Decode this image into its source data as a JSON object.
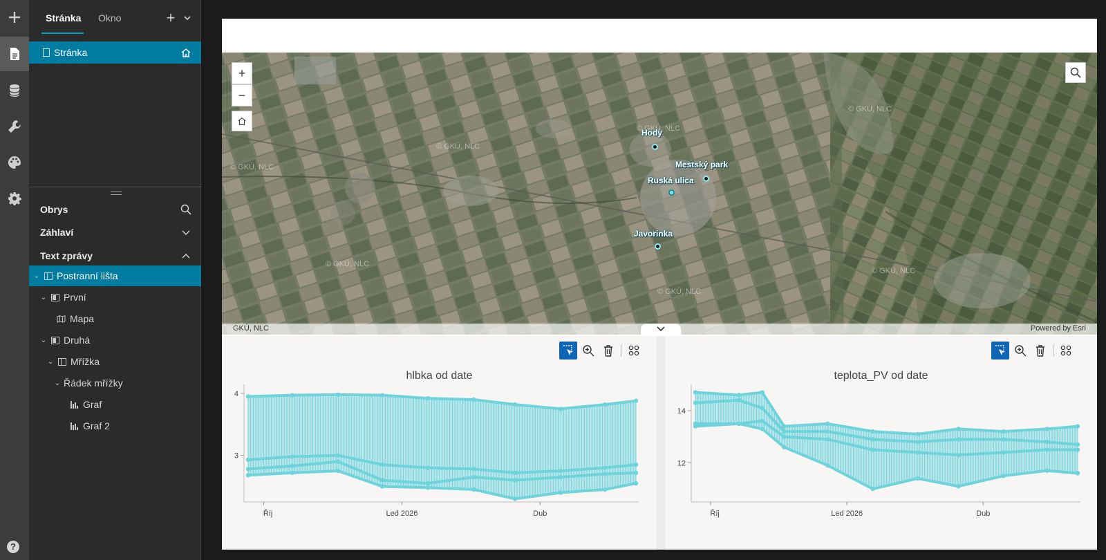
{
  "panel": {
    "tabs": [
      {
        "label": "Stránka",
        "active": true
      },
      {
        "label": "Okno",
        "active": false
      }
    ],
    "pages": [
      {
        "label": "Stránka"
      }
    ],
    "outline": {
      "title": "Obrys"
    },
    "sections": [
      {
        "label": "Záhlaví",
        "expanded": false
      },
      {
        "label": "Text zprávy",
        "expanded": true
      }
    ],
    "tree": [
      {
        "label": "Postranní lišta",
        "icon": "sidebar-layout-icon",
        "selected": true
      },
      {
        "label": "První",
        "icon": "section-icon"
      },
      {
        "label": "Mapa",
        "icon": "map-icon"
      },
      {
        "label": "Druhá",
        "icon": "section-icon"
      },
      {
        "label": "Mřížka",
        "icon": "grid-icon"
      },
      {
        "label": "Řádek mřížky",
        "icon": ""
      },
      {
        "label": "Graf",
        "icon": "bar-chart-icon"
      },
      {
        "label": "Graf 2",
        "icon": "bar-chart-icon"
      }
    ]
  },
  "map": {
    "attribution_left": "GKÚ, NLC",
    "attribution_right": "Powered by Esri",
    "watermarks": [
      "© GKÚ, NLC",
      "© GKÚ, NLC",
      "© GKÚ, NLC",
      "© GKÚ, NLC",
      "© GKÚ, NLC",
      "© GKÚ, NLC",
      "© GKÚ, NLC"
    ],
    "points": [
      {
        "name": "Hody"
      },
      {
        "name": "Mestský park"
      },
      {
        "name": "Ruská ulica"
      },
      {
        "name": "Javorinka"
      }
    ],
    "zoom_in": "+",
    "zoom_out": "−"
  },
  "chart_data": [
    {
      "type": "area",
      "title": "hlbka od date",
      "x_ticks": [
        "Říj",
        "Led 2026",
        "Dub"
      ],
      "y_ticks": [
        "3",
        "4"
      ],
      "ylim": [
        2.25,
        4.1
      ],
      "color": "#6fd3dc",
      "x": [
        "2025-09-20",
        "2025-10-20",
        "2025-11-20",
        "2025-12-20",
        "2026-01-20",
        "2026-02-20",
        "2026-03-20",
        "2026-04-20",
        "2026-05-20",
        "2026-06-10"
      ],
      "series": [
        {
          "values": [
            3.95,
            3.97,
            3.98,
            3.97,
            3.92,
            3.9,
            3.82,
            3.75,
            3.82,
            3.88
          ]
        },
        {
          "values": [
            2.93,
            2.98,
            3.0,
            2.85,
            2.8,
            2.78,
            2.72,
            2.75,
            2.8,
            2.85
          ]
        },
        {
          "values": [
            2.78,
            2.83,
            2.9,
            2.6,
            2.55,
            2.65,
            2.6,
            2.65,
            2.7,
            2.72
          ]
        },
        {
          "values": [
            2.68,
            2.72,
            2.75,
            2.5,
            2.48,
            2.45,
            2.3,
            2.4,
            2.45,
            2.55
          ]
        }
      ]
    },
    {
      "type": "area",
      "title": "teplota_PV od date",
      "x_ticks": [
        "Říj",
        "Led 2026",
        "Dub"
      ],
      "y_ticks": [
        "12",
        "14"
      ],
      "ylim": [
        10.5,
        14.9
      ],
      "color": "#6fd3dc",
      "x": [
        "2025-09-20",
        "2025-10-20",
        "2025-11-05",
        "2025-11-20",
        "2025-12-20",
        "2026-01-20",
        "2026-02-20",
        "2026-03-20",
        "2026-04-20",
        "2026-05-20",
        "2026-06-10"
      ],
      "series": [
        {
          "values": [
            14.7,
            14.6,
            14.7,
            13.4,
            13.5,
            13.2,
            13.1,
            13.3,
            13.2,
            13.3,
            13.4
          ]
        },
        {
          "values": [
            14.3,
            14.4,
            14.1,
            13.2,
            13.2,
            12.9,
            12.8,
            12.9,
            12.9,
            12.8,
            12.7
          ]
        },
        {
          "values": [
            13.5,
            13.5,
            13.6,
            13.0,
            12.9,
            12.5,
            12.4,
            12.3,
            12.4,
            12.5,
            12.5
          ]
        },
        {
          "values": [
            13.4,
            13.5,
            13.3,
            12.6,
            11.9,
            11.0,
            11.4,
            11.1,
            11.5,
            11.7,
            11.6
          ]
        }
      ]
    }
  ]
}
